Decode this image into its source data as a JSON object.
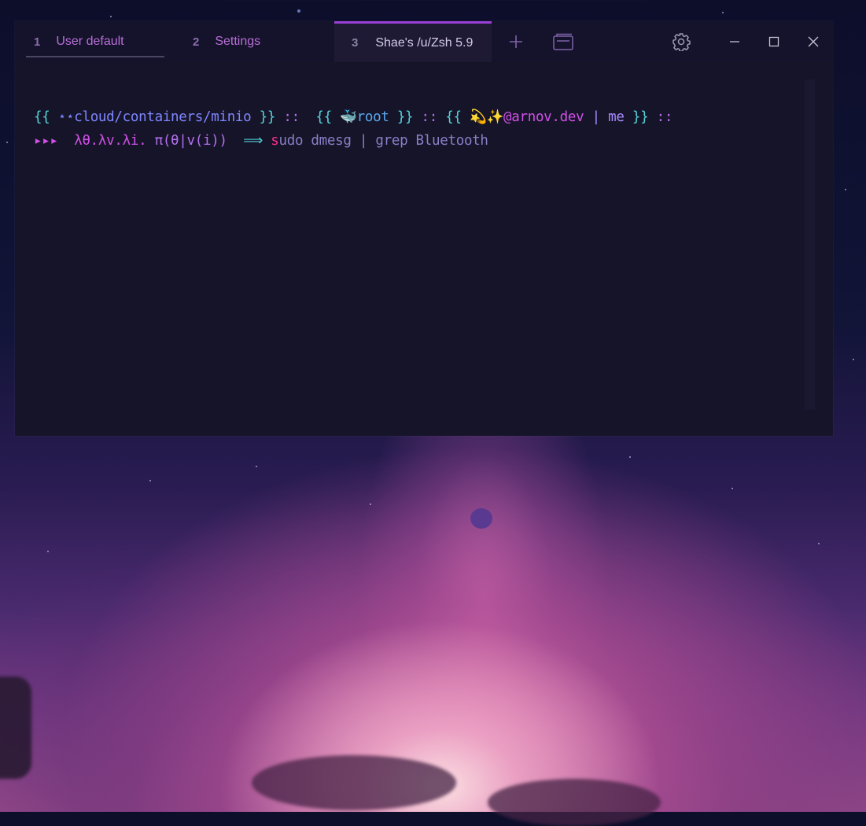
{
  "tabs": [
    {
      "num": "1",
      "label": "User default"
    },
    {
      "num": "2",
      "label": "Settings"
    },
    {
      "num": "3",
      "label": "Shae's /u/Zsh 5.9"
    }
  ],
  "prompt": {
    "open": "{{",
    "stars": "⋆⋆",
    "path": "cloud/containers/minio",
    "close": "}}",
    "sep": "::",
    "whale": "🐳",
    "user": "root",
    "sparkle": "💫✨",
    "host": "@arnov.dev",
    "pipe": "|",
    "me": "me",
    "arrows": "▸▸▸",
    "lambda": "λθ.λv.λi.",
    "pi": "π(θ|v(i))",
    "implies": "⟹",
    "cmd_first": "s",
    "cmd_rest": "udo dmesg",
    "cmd_pipe": "|",
    "cmd_tail": "grep Bluetooth"
  },
  "colors": {
    "accent": "#9b3fd6",
    "tab_text": "#b86ed8",
    "active_tab_text": "#d5cbe9"
  },
  "icons": [
    "plus-icon",
    "tab-overview-icon",
    "gear-icon",
    "minimize-icon",
    "maximize-icon",
    "close-icon"
  ]
}
